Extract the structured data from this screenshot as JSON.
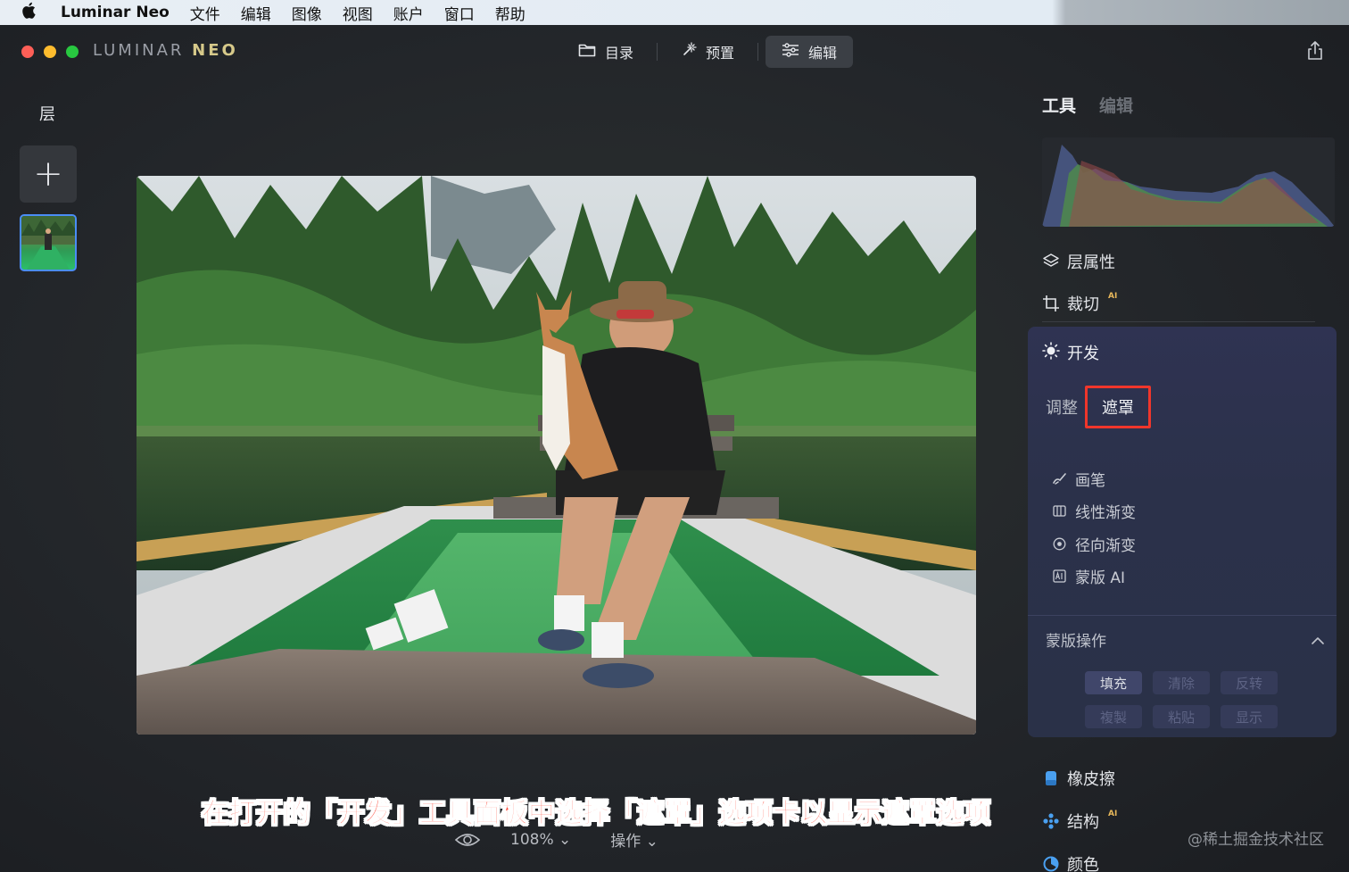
{
  "menubar": {
    "app_name": "Luminar Neo",
    "items": [
      "文件",
      "编辑",
      "图像",
      "视图",
      "账户",
      "窗口",
      "帮助"
    ]
  },
  "window": {
    "brand_light": "LUMINAR",
    "brand_bold": "NEO",
    "nav": [
      {
        "label": "目录",
        "icon": "folder-icon"
      },
      {
        "label": "预置",
        "icon": "magic-wand-icon"
      },
      {
        "label": "编辑",
        "icon": "sliders-icon",
        "active": true
      }
    ]
  },
  "layers": {
    "title": "层",
    "add_symbol": "+"
  },
  "bottombar": {
    "zoom": "108%",
    "zoom_caret": "⌄",
    "actions": "操作",
    "actions_caret": "⌄"
  },
  "caption": "在打开的「开发」工具面板中选择「遮罩」选项卡以显示遮罩选项",
  "watermark": "@稀土掘金技术社区",
  "right_panel": {
    "tabs": {
      "tools": "工具",
      "edits": "编辑"
    },
    "tools": [
      {
        "label": "层属性",
        "icon": "layers-icon"
      },
      {
        "label": "裁切",
        "icon": "crop-icon",
        "ai": "AI"
      }
    ],
    "develop": {
      "title": "开发",
      "tabs": {
        "adjust": "调整",
        "mask": "遮罩"
      },
      "mask_tools": [
        {
          "label": "画笔",
          "icon": "brush-icon"
        },
        {
          "label": "线性渐变",
          "icon": "linear-gradient-icon"
        },
        {
          "label": "径向渐变",
          "icon": "radial-gradient-icon"
        },
        {
          "label": "蒙版 AI",
          "icon": "mask-ai-icon"
        }
      ],
      "mask_ops_title": "蒙版操作",
      "mask_ops": [
        "填充",
        "清除",
        "反转",
        "複製",
        "粘贴",
        "显示"
      ],
      "mask_ops_enabled": [
        true,
        false,
        false,
        false,
        false,
        false
      ]
    },
    "more_tools": [
      {
        "label": "橡皮擦",
        "icon": "eraser-icon",
        "color": "#4aa0f0"
      },
      {
        "label": "结构",
        "icon": "structure-icon",
        "ai": "AI",
        "color": "#4aa0f0"
      },
      {
        "label": "颜色",
        "icon": "color-icon",
        "color": "#4aa0f0"
      }
    ]
  },
  "colors": {
    "accent_blue": "#4a8df6",
    "highlight_red": "#f0362b",
    "panel_purple": "#2f3352"
  }
}
